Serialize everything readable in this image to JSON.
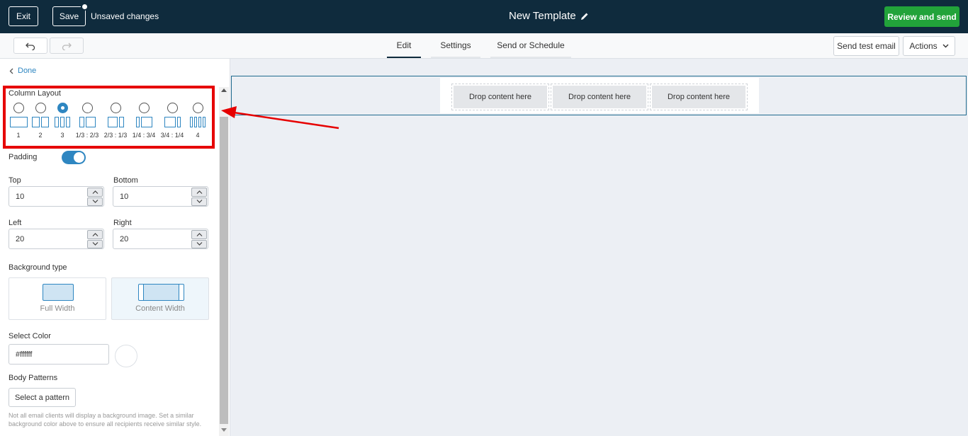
{
  "header": {
    "exit_label": "Exit",
    "save_label": "Save",
    "unsaved_text": "Unsaved changes",
    "title": "New Template",
    "review_label": "Review and send"
  },
  "subbar": {
    "tabs": [
      {
        "label": "Edit",
        "active": true
      },
      {
        "label": "Settings",
        "active": false
      },
      {
        "label": "Send or Schedule",
        "active": false
      }
    ],
    "send_test_label": "Send test email",
    "actions_label": "Actions"
  },
  "panel": {
    "done_label": "Done",
    "column_layout": {
      "label": "Column Layout",
      "options": [
        {
          "caption": "1",
          "checked": false
        },
        {
          "caption": "2",
          "checked": false
        },
        {
          "caption": "3",
          "checked": true
        },
        {
          "caption": "1/3 : 2/3",
          "checked": false
        },
        {
          "caption": "2/3 : 1/3",
          "checked": false
        },
        {
          "caption": "1/4 : 3/4",
          "checked": false
        },
        {
          "caption": "3/4 : 1/4",
          "checked": false
        },
        {
          "caption": "4",
          "checked": false
        }
      ]
    },
    "padding": {
      "label": "Padding",
      "enabled": true,
      "top_label": "Top",
      "top_value": "10",
      "bottom_label": "Bottom",
      "bottom_value": "10",
      "left_label": "Left",
      "left_value": "20",
      "right_label": "Right",
      "right_value": "20"
    },
    "background": {
      "label": "Background type",
      "full_width_label": "Full Width",
      "content_width_label": "Content Width",
      "selected": "Content Width"
    },
    "color": {
      "label": "Select Color",
      "value": "#ffffff"
    },
    "patterns": {
      "label": "Body Patterns",
      "button_label": "Select a pattern",
      "note": "Not all email clients will display a background image. Set a similar background color above to ensure all recipients receive similar style."
    }
  },
  "canvas": {
    "drop_zones": [
      "Drop content here",
      "Drop content here",
      "Drop content here"
    ]
  },
  "colors": {
    "header_bg": "#0f2b3d",
    "accent": "#2e86c1",
    "review_green": "#22a33a",
    "highlight_red": "#e60000"
  },
  "icons": [
    "undo-icon",
    "redo-icon",
    "pencil-icon",
    "chevron-down-icon",
    "chevron-left-icon",
    "arrow-annotation"
  ]
}
